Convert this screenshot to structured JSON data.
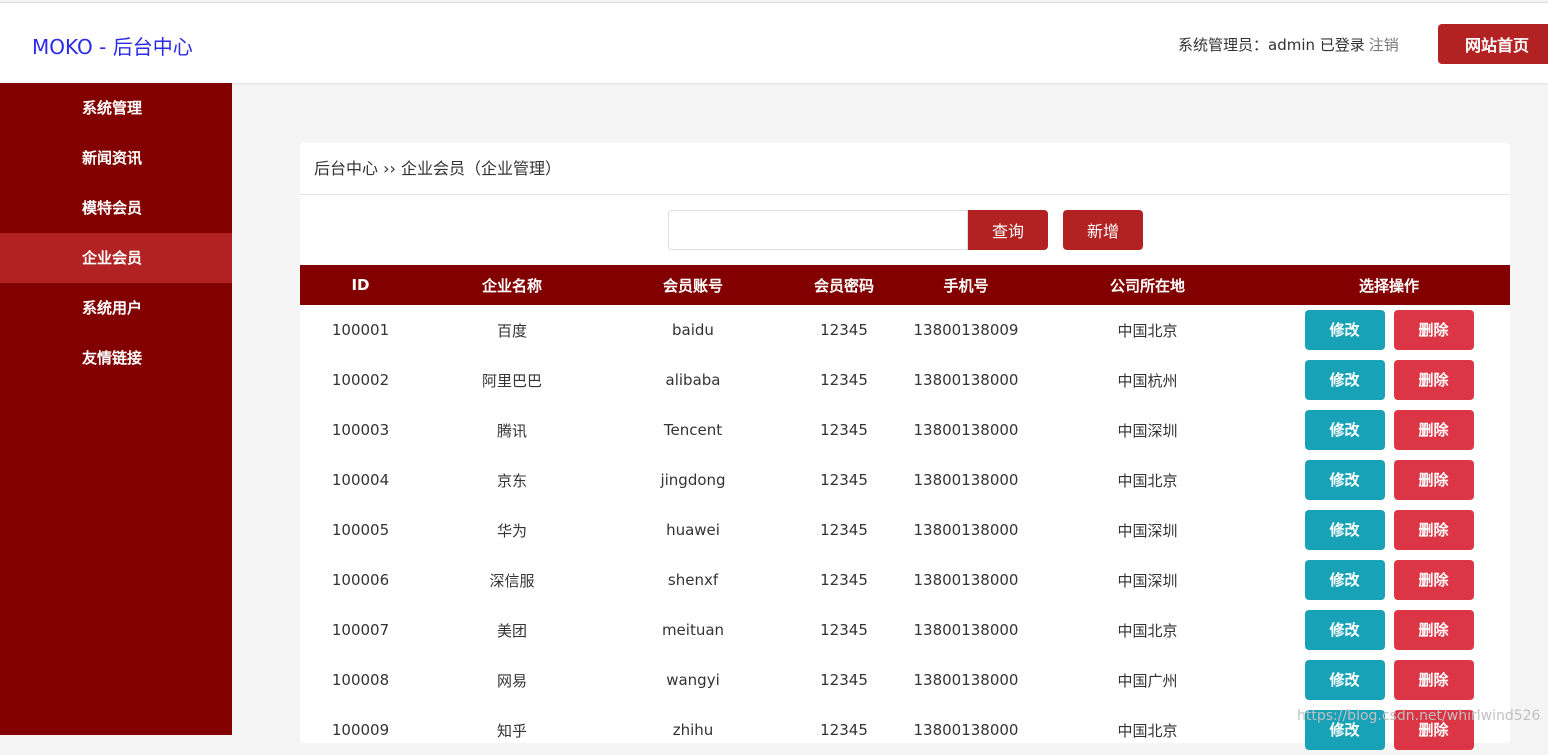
{
  "header": {
    "logo": "MOKO - 后台中心",
    "login_text": "系统管理员：admin 已登录",
    "logout": "注销",
    "home_button": "网站首页"
  },
  "sidebar": {
    "items": [
      {
        "label": "系统管理"
      },
      {
        "label": "新闻资讯"
      },
      {
        "label": "模特会员"
      },
      {
        "label": "企业会员"
      },
      {
        "label": "系统用户"
      },
      {
        "label": "友情链接"
      }
    ],
    "active_index": 3
  },
  "breadcrumb": "后台中心 ›› 企业会员（企业管理）",
  "search": {
    "value": "",
    "query_label": "查询",
    "add_label": "新增"
  },
  "table": {
    "headers": [
      "ID",
      "企业名称",
      "会员账号",
      "会员密码",
      "手机号",
      "公司所在地",
      "选择操作"
    ],
    "rows": [
      [
        "100001",
        "百度",
        "baidu",
        "12345",
        "13800138009",
        "中国北京"
      ],
      [
        "100002",
        "阿里巴巴",
        "alibaba",
        "12345",
        "13800138000",
        "中国杭州"
      ],
      [
        "100003",
        "腾讯",
        "Tencent",
        "12345",
        "13800138000",
        "中国深圳"
      ],
      [
        "100004",
        "京东",
        "jingdong",
        "12345",
        "13800138000",
        "中国北京"
      ],
      [
        "100005",
        "华为",
        "huawei",
        "12345",
        "13800138000",
        "中国深圳"
      ],
      [
        "100006",
        "深信服",
        "shenxf",
        "12345",
        "13800138000",
        "中国深圳"
      ],
      [
        "100007",
        "美团",
        "meituan",
        "12345",
        "13800138000",
        "中国北京"
      ],
      [
        "100008",
        "网易",
        "wangyi",
        "12345",
        "13800138000",
        "中国广州"
      ],
      [
        "100009",
        "知乎",
        "zhihu",
        "12345",
        "13800138000",
        "中国北京"
      ]
    ],
    "edit_label": "修改",
    "delete_label": "删除"
  },
  "watermark": "https://blog.csdn.net/whirlwind526",
  "colors": {
    "primary": "#820000",
    "accent": "#b22222",
    "edit": "#17a2b8",
    "delete": "#dc3545",
    "logo": "#2b2be8"
  }
}
